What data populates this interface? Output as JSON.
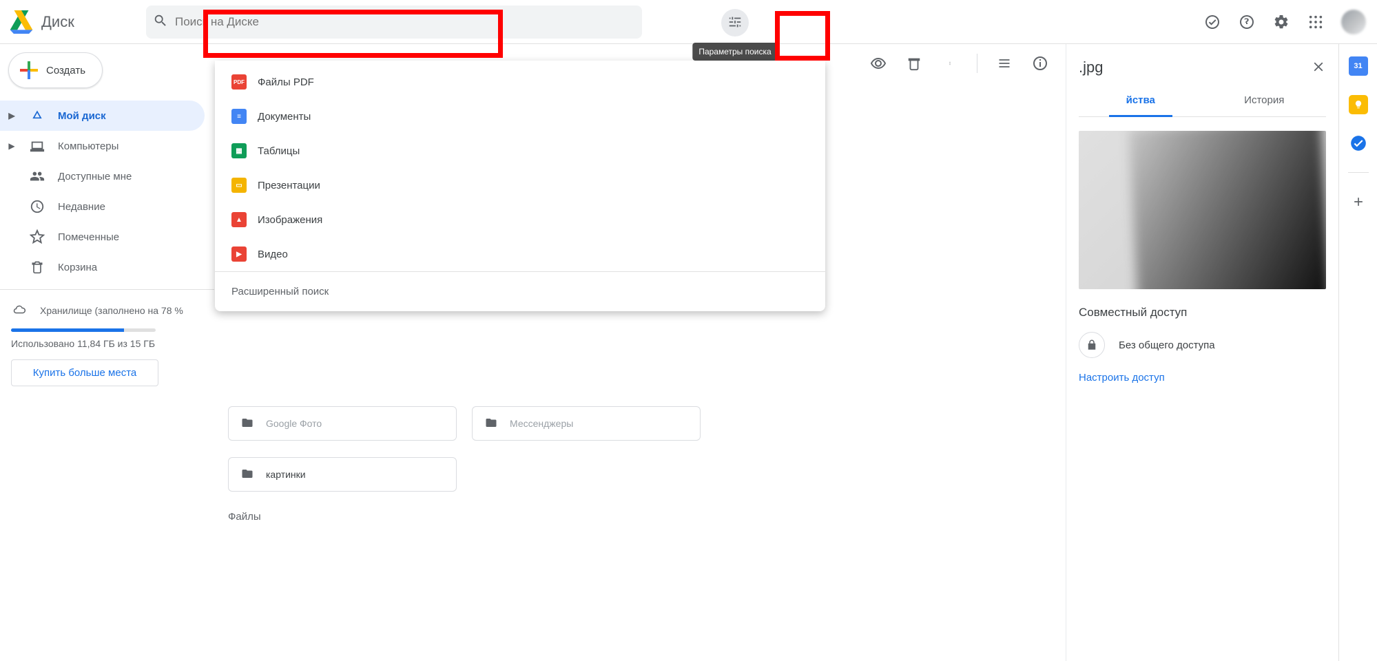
{
  "app": {
    "product": "Диск"
  },
  "search": {
    "placeholder": "Поиск на Диске",
    "tune_tooltip": "Параметры поиска",
    "dropdown": {
      "items": [
        {
          "label": "Файлы PDF",
          "color": "#ea4335",
          "mark": "PDF"
        },
        {
          "label": "Документы",
          "color": "#4285f4",
          "mark": "≡"
        },
        {
          "label": "Таблицы",
          "color": "#0f9d58",
          "mark": "▦"
        },
        {
          "label": "Презентации",
          "color": "#f4b400",
          "mark": "▭"
        },
        {
          "label": "Изображения",
          "color": "#ea4335",
          "mark": "▲"
        },
        {
          "label": "Видео",
          "color": "#ea4335",
          "mark": "▶"
        }
      ],
      "footer": "Расширенный поиск"
    }
  },
  "sidebar": {
    "create": "Создать",
    "items": [
      {
        "label": "Мой диск",
        "expandable": true,
        "active": true
      },
      {
        "label": "Компьютеры",
        "expandable": true,
        "active": false
      },
      {
        "label": "Доступные мне",
        "expandable": false,
        "active": false
      },
      {
        "label": "Недавние",
        "expandable": false,
        "active": false
      },
      {
        "label": "Помеченные",
        "expandable": false,
        "active": false
      },
      {
        "label": "Корзина",
        "expandable": false,
        "active": false
      }
    ],
    "storage": {
      "title": "Хранилище (заполнено на 78 %",
      "used_text": "Использовано 11,84 ГБ из 15 ГБ",
      "percent": 78,
      "buy": "Купить больше места"
    }
  },
  "main": {
    "folders_top_row": [
      {
        "label": "Google Фото"
      },
      {
        "label": "Мессенджеры"
      }
    ],
    "folders_second_row": [
      {
        "label": "картинки"
      }
    ],
    "files_heading": "Файлы"
  },
  "details": {
    "file_name_suffix": ".jpg",
    "tabs": {
      "properties": "йства",
      "history": "История"
    },
    "share_heading": "Совместный доступ",
    "share_status": "Без общего доступа",
    "share_action": "Настроить доступ"
  }
}
